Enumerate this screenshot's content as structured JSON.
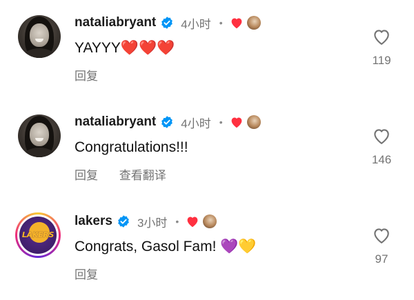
{
  "comments": [
    {
      "username": "nataliabryant",
      "time": "4小时",
      "dot": "•",
      "text": "YAYYY❤️❤️❤️",
      "reply_label": "回复",
      "translate_label": "",
      "like_count": "119",
      "avatar": "profile-photo"
    },
    {
      "username": "nataliabryant",
      "time": "4小时",
      "dot": "•",
      "text": "Congratulations!!!",
      "reply_label": "回复",
      "translate_label": "查看翻译",
      "like_count": "146",
      "avatar": "profile-photo"
    },
    {
      "username": "lakers",
      "time": "3小时",
      "dot": "•",
      "text": "Congrats, Gasol Fam! 💜💛",
      "reply_label": "回复",
      "translate_label": "",
      "like_count": "97",
      "avatar": "lakers-logo",
      "logo_text": "LAKERS"
    }
  ],
  "colors": {
    "verified": "#0095f6",
    "liked_heart": "#ff3040",
    "secondary_text": "#737373",
    "lakers_purple": "#552583",
    "lakers_gold": "#fdb927"
  },
  "icons": {
    "verified": "verified-badge-icon",
    "creator_like": "heart-filled-icon",
    "like": "heart-outline-icon"
  }
}
